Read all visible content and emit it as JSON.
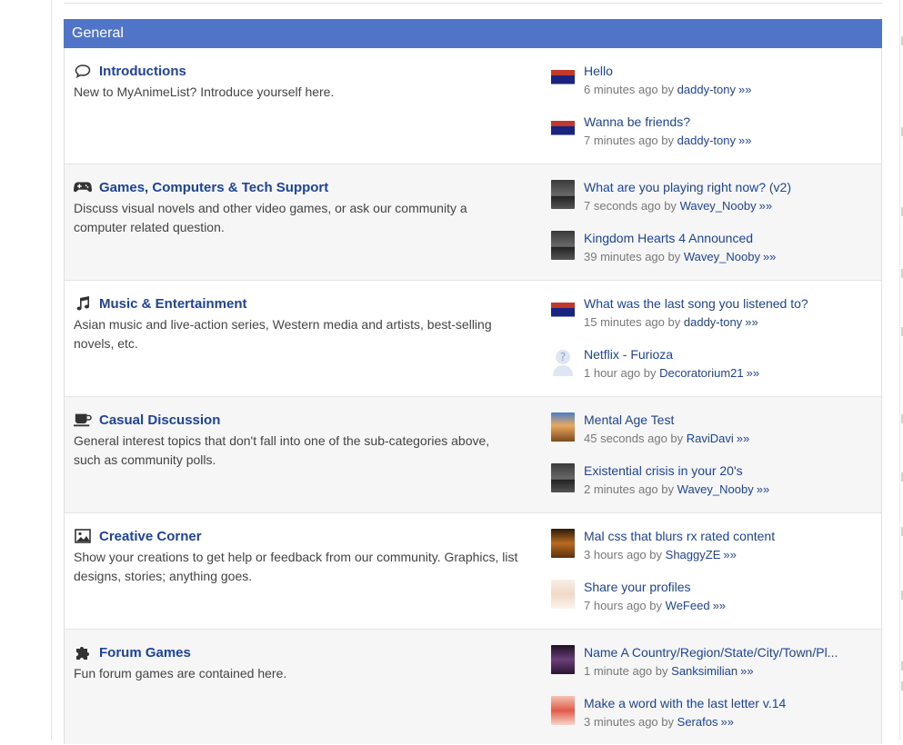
{
  "section": {
    "title": "General"
  },
  "categories": [
    {
      "icon": "speech-bubble-icon",
      "name": "Introductions",
      "description": "New to MyAnimeList? Introduce yourself here.",
      "topics": [
        {
          "title": "Hello",
          "time": "6 minutes ago",
          "by": "by",
          "user": "daddy-tony",
          "arrows": "»»",
          "avatar": "daddy"
        },
        {
          "title": "Wanna be friends?",
          "time": "7 minutes ago",
          "by": "by",
          "user": "daddy-tony",
          "arrows": "»»",
          "avatar": "daddy"
        }
      ]
    },
    {
      "icon": "gamepad-icon",
      "name": "Games, Computers & Tech Support",
      "description": "Discuss visual novels and other video games, or ask our community a computer related question.",
      "topics": [
        {
          "title": "What are you playing right now? (v2)",
          "time": "7 seconds ago",
          "by": "by",
          "user": "Wavey_Nooby",
          "arrows": "»»",
          "avatar": "wavey"
        },
        {
          "title": "Kingdom Hearts 4 Announced",
          "time": "39 minutes ago",
          "by": "by",
          "user": "Wavey_Nooby",
          "arrows": "»»",
          "avatar": "wavey"
        }
      ]
    },
    {
      "icon": "music-note-icon",
      "name": "Music & Entertainment",
      "description": "Asian music and live-action series, Western media and artists, best-selling novels, etc.",
      "topics": [
        {
          "title": "What was the last song you listened to?",
          "time": "15 minutes ago",
          "by": "by",
          "user": "daddy-tony",
          "arrows": "»»",
          "avatar": "daddy"
        },
        {
          "title": "Netflix - Furioza",
          "time": "1 hour ago",
          "by": "by",
          "user": "Decoratorium21",
          "arrows": "»»",
          "avatar": "deco"
        }
      ]
    },
    {
      "icon": "coffee-cup-icon",
      "name": "Casual Discussion",
      "description": "General interest topics that don't fall into one of the sub-categories above, such as community polls.",
      "topics": [
        {
          "title": "Mental Age Test",
          "time": "45 seconds ago",
          "by": "by",
          "user": "RaviDavi",
          "arrows": "»»",
          "avatar": "ravi"
        },
        {
          "title": "Existential crisis in your 20's",
          "time": "2 minutes ago",
          "by": "by",
          "user": "Wavey_Nooby",
          "arrows": "»»",
          "avatar": "wavey"
        }
      ]
    },
    {
      "icon": "image-icon",
      "name": "Creative Corner",
      "description": "Show your creations to get help or feedback from our community. Graphics, list designs, stories; anything goes.",
      "topics": [
        {
          "title": "Mal css that blurs rx rated content",
          "time": "3 hours ago",
          "by": "by",
          "user": "ShaggyZE",
          "arrows": "»»",
          "avatar": "shaggy"
        },
        {
          "title": "Share your profiles",
          "time": "7 hours ago",
          "by": "by",
          "user": "WeFeed",
          "arrows": "»»",
          "avatar": "wefeed"
        }
      ]
    },
    {
      "icon": "puzzle-piece-icon",
      "name": "Forum Games",
      "description": "Fun forum games are contained here.",
      "topics": [
        {
          "title": "Name A Country/Region/State/City/Town/Pl...",
          "time": "1 minute ago",
          "by": "by",
          "user": "Sanksimilian",
          "arrows": "»»",
          "avatar": "sanks"
        },
        {
          "title": "Make a word with the last letter v.14",
          "time": "3 minutes ago",
          "by": "by",
          "user": "Serafos",
          "arrows": "»»",
          "avatar": "sera"
        }
      ]
    }
  ]
}
